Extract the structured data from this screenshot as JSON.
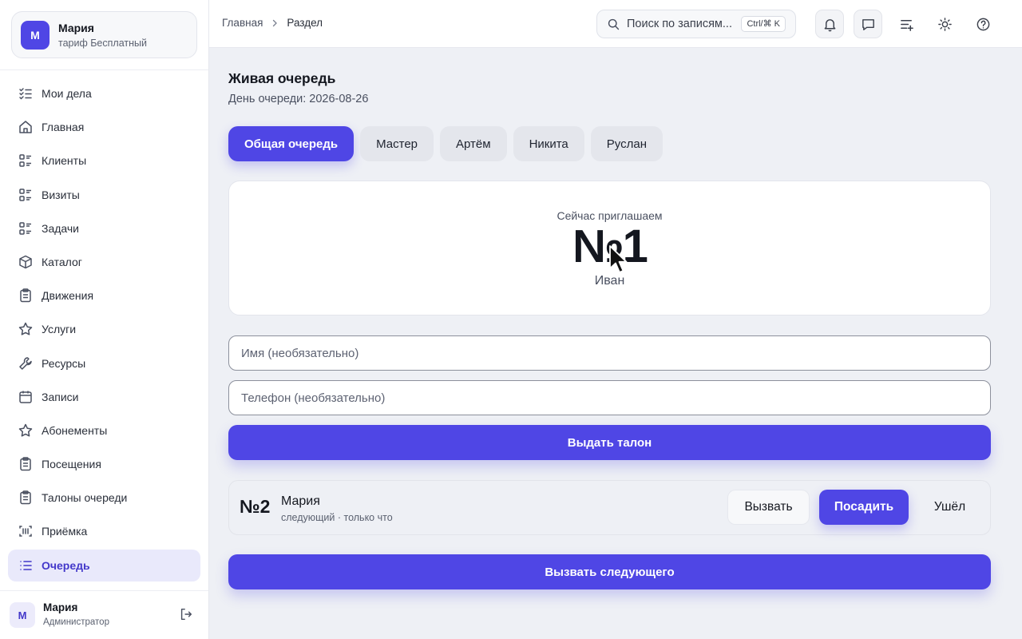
{
  "sidebar": {
    "tenant": {
      "initial": "М",
      "name": "Мария",
      "plan": "тариф Бесплатный"
    },
    "items": [
      {
        "label": "Мои дела",
        "icon": "checklist-icon"
      },
      {
        "label": "Главная",
        "icon": "home-icon"
      },
      {
        "label": "Клиенты",
        "icon": "list-icon"
      },
      {
        "label": "Визиты",
        "icon": "list-icon"
      },
      {
        "label": "Задачи",
        "icon": "list-icon"
      },
      {
        "label": "Каталог",
        "icon": "box-icon"
      },
      {
        "label": "Движения",
        "icon": "clipboard-icon"
      },
      {
        "label": "Услуги",
        "icon": "star-icon"
      },
      {
        "label": "Ресурсы",
        "icon": "wrench-icon"
      },
      {
        "label": "Записи",
        "icon": "calendar-icon"
      },
      {
        "label": "Абонементы",
        "icon": "star-icon"
      },
      {
        "label": "Посещения",
        "icon": "clipboard-icon"
      },
      {
        "label": "Талоны очереди",
        "icon": "clipboard-icon"
      },
      {
        "label": "Приёмка",
        "icon": "barcode-icon"
      },
      {
        "label": "Очередь",
        "icon": "queue-list-icon",
        "active": true
      }
    ],
    "user": {
      "initial": "М",
      "name": "Мария",
      "role": "Администратор"
    }
  },
  "topbar": {
    "breadcrumb": {
      "home": "Главная",
      "current": "Раздел"
    },
    "search": {
      "placeholder": "Поиск по записям",
      "shortcut": "Ctrl/⌘ K"
    },
    "icons": [
      "bell-icon",
      "chat-icon",
      "add-list-icon",
      "sun-icon",
      "help-icon"
    ]
  },
  "main": {
    "title": "Живая очередь",
    "subtitle": "День очереди: 2026-08-26",
    "tabs": [
      {
        "label": "Общая очередь",
        "active": true
      },
      {
        "label": "Мастер"
      },
      {
        "label": "Артём"
      },
      {
        "label": "Никита"
      },
      {
        "label": "Руслан"
      }
    ],
    "now": {
      "label": "Сейчас приглашаем",
      "number": "№1",
      "name": "Иван"
    },
    "form": {
      "name_placeholder": "Имя (необязательно)",
      "phone_placeholder": "Телефон (необязательно)",
      "issue_label": "Выдать талон"
    },
    "queue": [
      {
        "number": "№2",
        "name": "Мария",
        "meta": "следующий · только что",
        "actions": {
          "call": "Вызвать",
          "seat": "Посадить",
          "left": "Ушёл"
        }
      }
    ],
    "call_next_label": "Вызвать следующего"
  },
  "colors": {
    "accent": "#4f46e5",
    "active_nav_bg": "#e9e9fb",
    "page_bg": "#eef0f5"
  }
}
